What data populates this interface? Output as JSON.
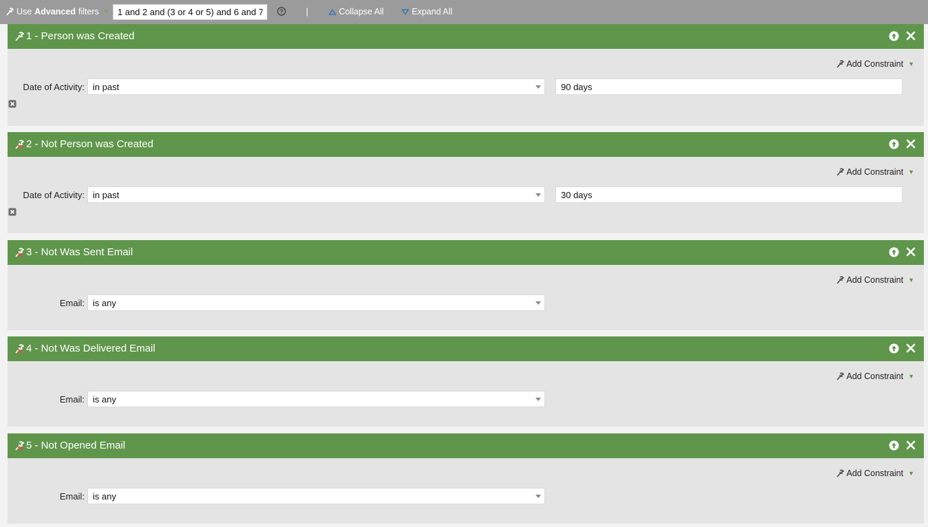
{
  "toolbar": {
    "use_label": "Use",
    "advanced_label": "Advanced",
    "filters_label": "filters",
    "filter_logic": "1 and 2 and (3 or 4 or 5) and 6 and 7",
    "separator": "|",
    "collapse_all": "Collapse All",
    "expand_all": "Expand All"
  },
  "colors": {
    "header_green": "#5f964b",
    "toolbar_gray": "#9b9b9b",
    "panel_gray": "#e4e4e4"
  },
  "filters": [
    {
      "title": "1 - Person was Created",
      "add_constraint": "Add Constraint",
      "constraint_label": "Date of Activity:",
      "operator": "in past",
      "value": "90 days"
    },
    {
      "title": "2 - Not Person was Created",
      "add_constraint": "Add Constraint",
      "constraint_label": "Date of Activity:",
      "operator": "in past",
      "value": "30 days"
    },
    {
      "title": "3 - Not Was Sent Email",
      "add_constraint": "Add Constraint",
      "constraint_label": "Email:",
      "operator": "is any"
    },
    {
      "title": "4 - Not Was Delivered Email",
      "add_constraint": "Add Constraint",
      "constraint_label": "Email:",
      "operator": "is any"
    },
    {
      "title": "5 - Not Opened Email",
      "add_constraint": "Add Constraint",
      "constraint_label": "Email:",
      "operator": "is any"
    }
  ]
}
